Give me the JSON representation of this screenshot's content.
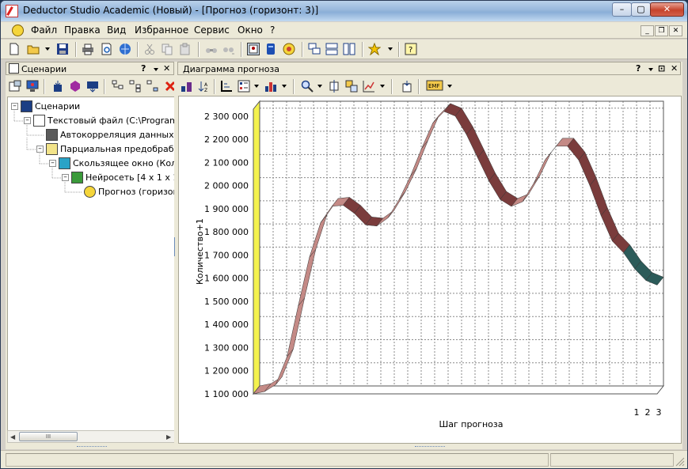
{
  "window": {
    "title": "Deductor Studio Academic (Новый) - [Прогноз (горизонт: 3)]",
    "controls": {
      "minimize": "–",
      "maximize": "▢",
      "close": "✕"
    }
  },
  "menu": {
    "items": [
      "Файл",
      "Правка",
      "Вид",
      "Избранное",
      "Сервис",
      "Окно",
      "?"
    ]
  },
  "left_panel": {
    "title": "Сценарии",
    "help": "?",
    "close": "✕",
    "tree": [
      {
        "label": "Сценарии",
        "level": 0,
        "expander": "–",
        "icon": "scenarios-icon"
      },
      {
        "label": "Текстовый файл (C:\\Program Fil",
        "level": 1,
        "expander": "–",
        "icon": "text-file-icon"
      },
      {
        "label": "Автокорреляция данных Кол",
        "level": 2,
        "expander": "",
        "icon": "autocorrelation-icon"
      },
      {
        "label": "Парциальная предобработк",
        "level": 2,
        "expander": "–",
        "icon": "preprocessing-icon"
      },
      {
        "label": "Скользящее окно (Колич",
        "level": 3,
        "expander": "–",
        "icon": "sliding-window-icon"
      },
      {
        "label": "Нейросеть [4 x 1 x 1]",
        "level": 4,
        "expander": "–",
        "icon": "neural-net-icon"
      },
      {
        "label": "Прогноз (горизонт:",
        "level": 5,
        "expander": "",
        "icon": "forecast-icon"
      }
    ],
    "scroll_thumb": "III"
  },
  "right_panel": {
    "title": "Диаграмма прогноза",
    "help": "?",
    "close": "✕"
  },
  "colors": {
    "history": "#c48a86",
    "history_dark": "#7a3c3c",
    "forecast": "#4f8f8c",
    "forecast_dark": "#2c5b59",
    "back_wall": "#f4f24e",
    "grid": "#8a8a8a"
  },
  "chart_data": {
    "type": "line",
    "style": "3d-ribbon",
    "ylabel": "Количество+1",
    "xlabel": "Шаг прогноза",
    "y_ticks": [
      1100000,
      1200000,
      1300000,
      1400000,
      1500000,
      1600000,
      1700000,
      1800000,
      1900000,
      2000000,
      2100000,
      2200000,
      2300000
    ],
    "y_tick_labels": [
      "1 100 000",
      "1 200 000",
      "1 300 000",
      "1 400 000",
      "1 500 000",
      "1 600 000",
      "1 700 000",
      "1 800 000",
      "1 900 000",
      "2 000 000",
      "2 100 000",
      "2 200 000",
      "2 300 000"
    ],
    "ylim": [
      1100000,
      2330000
    ],
    "x_tick_labels": [
      "1",
      "2",
      "3"
    ],
    "grid": true,
    "series": [
      {
        "role": "history",
        "values": [
          1100000,
          1110000,
          1140000,
          1260000,
          1480000,
          1690000,
          1840000,
          1910000,
          1915000,
          1880000,
          1830000,
          1825000,
          1860000,
          1940000,
          2040000,
          2160000,
          2270000,
          2320000,
          2300000,
          2220000,
          2120000,
          2020000,
          1940000,
          1910000,
          1930000,
          2010000,
          2110000,
          2170000,
          2170000,
          2110000,
          2000000,
          1870000,
          1760000,
          1710000
        ]
      },
      {
        "role": "forecast",
        "values": [
          1710000,
          1640000,
          1590000,
          1570000
        ]
      }
    ]
  }
}
